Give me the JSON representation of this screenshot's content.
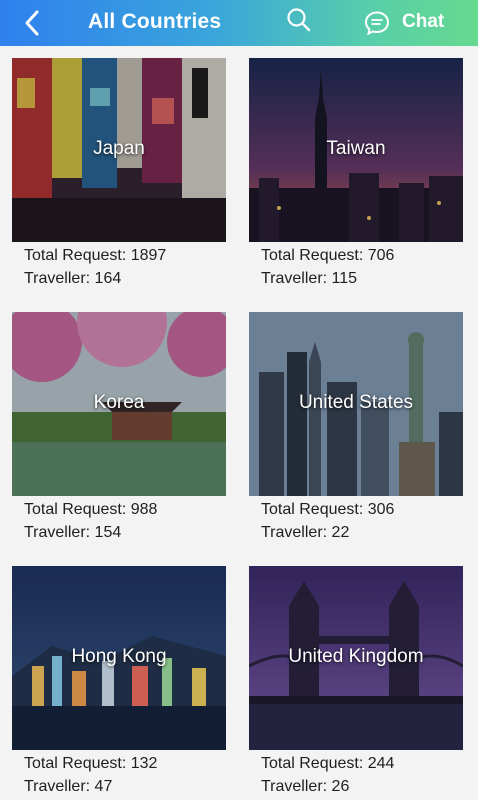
{
  "header": {
    "title": "All Countries",
    "chat_label": "Chat",
    "gradient_start": "#2f80ee",
    "gradient_end": "#66d98f",
    "back_icon": "chevron-left-icon",
    "search_icon": "search-icon",
    "chat_icon": "chat-bubble-icon"
  },
  "stats_labels": {
    "requests": "Total Request:",
    "travellers": "Traveller:"
  },
  "countries": [
    {
      "name": "Japan",
      "total_request": "1897",
      "traveller": "164"
    },
    {
      "name": "Taiwan",
      "total_request": "706",
      "traveller": "115"
    },
    {
      "name": "Korea",
      "total_request": "988",
      "traveller": "154"
    },
    {
      "name": "United States",
      "total_request": "306",
      "traveller": "22"
    },
    {
      "name": "Hong Kong",
      "total_request": "132",
      "traveller": "47"
    },
    {
      "name": "United Kingdom",
      "total_request": "244",
      "traveller": "26"
    }
  ]
}
